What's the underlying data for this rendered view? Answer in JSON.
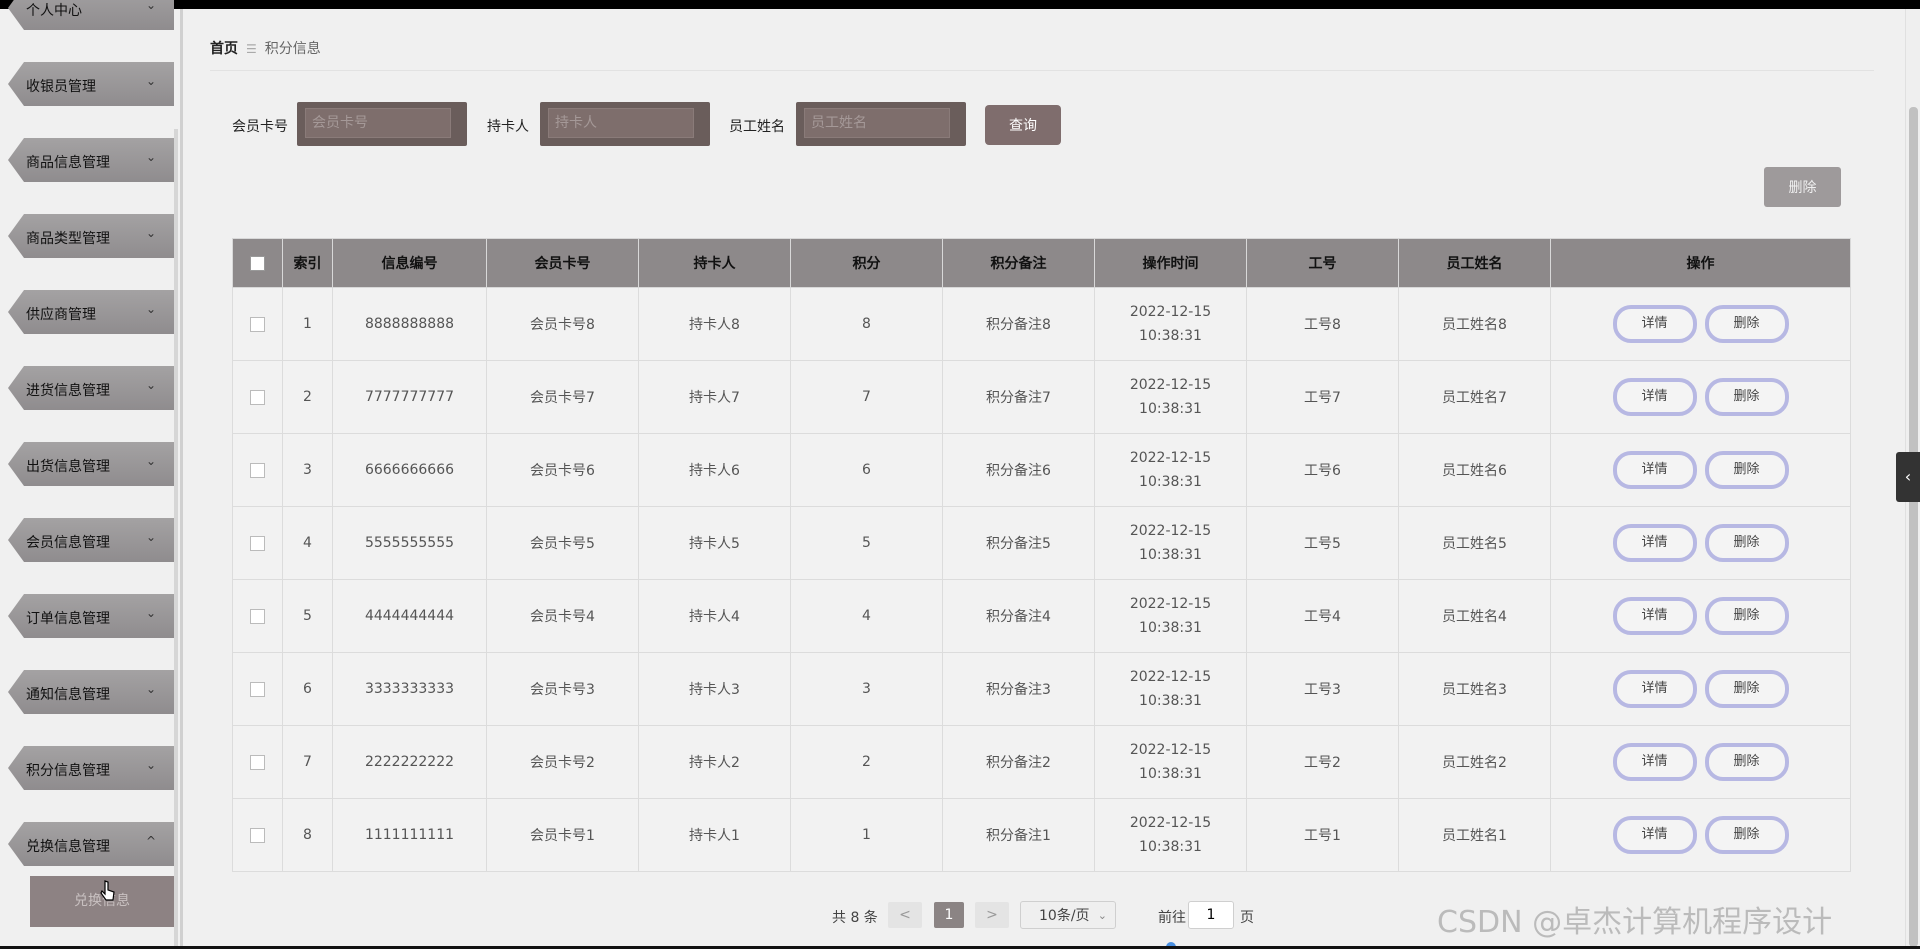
{
  "sidebar": {
    "items": [
      {
        "label": "个人中心"
      },
      {
        "label": "收银员管理"
      },
      {
        "label": "商品信息管理"
      },
      {
        "label": "商品类型管理"
      },
      {
        "label": "供应商管理"
      },
      {
        "label": "进货信息管理"
      },
      {
        "label": "出货信息管理"
      },
      {
        "label": "会员信息管理"
      },
      {
        "label": "订单信息管理"
      },
      {
        "label": "通知信息管理"
      },
      {
        "label": "积分信息管理"
      },
      {
        "label": "兑换信息管理"
      }
    ],
    "chevron_down": "⌄",
    "chevron_up": "^",
    "submenu_label": "兑换信息"
  },
  "breadcrumb": {
    "home": "首页",
    "sep": "☰",
    "current": "积分信息"
  },
  "search": {
    "card_label": "会员卡号",
    "card_placeholder": "会员卡号",
    "holder_label": "持卡人",
    "holder_placeholder": "持卡人",
    "staff_label": "员工姓名",
    "staff_placeholder": "员工姓名",
    "query_button": "查询"
  },
  "toolbar": {
    "delete_button": "删除"
  },
  "table": {
    "headers": {
      "index": "索引",
      "info_no": "信息编号",
      "card_no": "会员卡号",
      "holder": "持卡人",
      "points": "积分",
      "points_note": "积分备注",
      "op_time": "操作时间",
      "staff_no": "工号",
      "staff_name": "员工姓名",
      "actions": "操作"
    },
    "detail_button": "详情",
    "delete_button": "删除",
    "rows": [
      {
        "index": "1",
        "info_no": "8888888888",
        "card_no": "会员卡号8",
        "holder": "持卡人8",
        "points": "8",
        "note": "积分备注8",
        "time": "2022-12-15 10:38:31",
        "staff_no": "工号8",
        "staff_name": "员工姓名8"
      },
      {
        "index": "2",
        "info_no": "7777777777",
        "card_no": "会员卡号7",
        "holder": "持卡人7",
        "points": "7",
        "note": "积分备注7",
        "time": "2022-12-15 10:38:31",
        "staff_no": "工号7",
        "staff_name": "员工姓名7"
      },
      {
        "index": "3",
        "info_no": "6666666666",
        "card_no": "会员卡号6",
        "holder": "持卡人6",
        "points": "6",
        "note": "积分备注6",
        "time": "2022-12-15 10:38:31",
        "staff_no": "工号6",
        "staff_name": "员工姓名6"
      },
      {
        "index": "4",
        "info_no": "5555555555",
        "card_no": "会员卡号5",
        "holder": "持卡人5",
        "points": "5",
        "note": "积分备注5",
        "time": "2022-12-15 10:38:31",
        "staff_no": "工号5",
        "staff_name": "员工姓名5"
      },
      {
        "index": "5",
        "info_no": "4444444444",
        "card_no": "会员卡号4",
        "holder": "持卡人4",
        "points": "4",
        "note": "积分备注4",
        "time": "2022-12-15 10:38:31",
        "staff_no": "工号4",
        "staff_name": "员工姓名4"
      },
      {
        "index": "6",
        "info_no": "3333333333",
        "card_no": "会员卡号3",
        "holder": "持卡人3",
        "points": "3",
        "note": "积分备注3",
        "time": "2022-12-15 10:38:31",
        "staff_no": "工号3",
        "staff_name": "员工姓名3"
      },
      {
        "index": "7",
        "info_no": "2222222222",
        "card_no": "会员卡号2",
        "holder": "持卡人2",
        "points": "2",
        "note": "积分备注2",
        "time": "2022-12-15 10:38:31",
        "staff_no": "工号2",
        "staff_name": "员工姓名2"
      },
      {
        "index": "8",
        "info_no": "1111111111",
        "card_no": "会员卡号1",
        "holder": "持卡人1",
        "points": "1",
        "note": "积分备注1",
        "time": "2022-12-15 10:38:31",
        "staff_no": "工号1",
        "staff_name": "员工姓名1"
      }
    ]
  },
  "pagination": {
    "total_text": "共 8 条",
    "prev": "<",
    "current_page": "1",
    "next": ">",
    "page_size": "10条/页",
    "goto_label": "前往",
    "goto_value": "1",
    "page_suffix": "页"
  },
  "side_toggle": "‹",
  "watermark": "CSDN @卓杰计算机程序设计",
  "icons": {
    "chevron": "chevron-down-icon",
    "toggle": "chevron-left-icon",
    "cursor": "pointer-cursor-icon"
  }
}
